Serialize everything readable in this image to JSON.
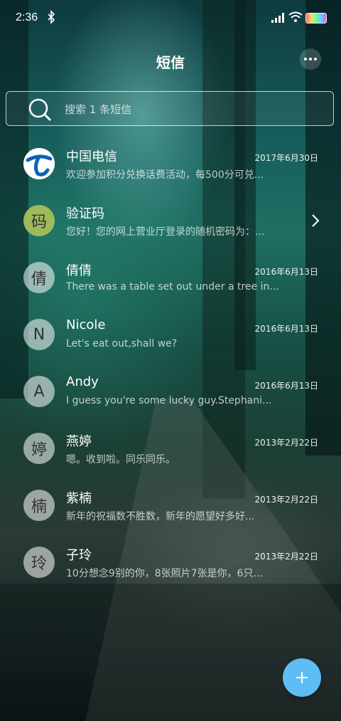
{
  "status_bar": {
    "time": "2:36"
  },
  "header": {
    "title": "短信"
  },
  "search": {
    "placeholder": "搜索 1 条短信"
  },
  "conversations": [
    {
      "avatar": "",
      "avatar_icon": "china-telecom-logo",
      "name": "中国电信",
      "date": "2017年6月30日",
      "preview": "欢迎参加积分兑换话费活动，每500分可兑..."
    },
    {
      "avatar": "码",
      "name": "验证码",
      "date": "",
      "preview": "您好！您的网上营业厅登录的随机密码为：..."
    },
    {
      "avatar": "倩",
      "name": "倩倩",
      "date": "2016年6月13日",
      "preview": "There was a table set out under a tree in..."
    },
    {
      "avatar": "N",
      "name": "Nicole",
      "date": "2016年6月13日",
      "preview": "Let's eat out,shall we?"
    },
    {
      "avatar": "A",
      "name": "Andy",
      "date": "2016年6月13日",
      "preview": "I guess you're some lucky guy.Stephani..."
    },
    {
      "avatar": "婷",
      "name": "燕婷",
      "date": "2013年2月22日",
      "preview": "嗯。收到啦。同乐同乐。"
    },
    {
      "avatar": "楠",
      "name": "紫楠",
      "date": "2013年2月22日",
      "preview": "新年的祝福数不胜数，新年的愿望好多好..."
    },
    {
      "avatar": "玲",
      "name": "子玲",
      "date": "2013年2月22日",
      "preview": "10分想念9别的你，8张照片7张是你，6只..."
    }
  ],
  "colors": {
    "fab": "#5ebdf2",
    "verify_avatar": "#9dbb59",
    "telecom_blue": "#0a63b8"
  }
}
